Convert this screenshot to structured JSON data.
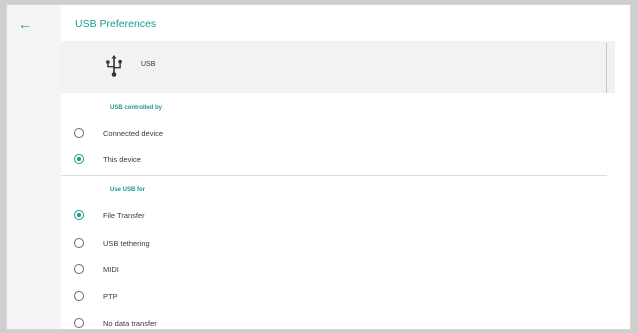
{
  "header": {
    "title": "USB Preferences"
  },
  "usb_item": {
    "label": "USB"
  },
  "controlled_by": {
    "heading": "USB controlled by",
    "options": [
      {
        "label": "Connected device",
        "checked": false
      },
      {
        "label": "This device",
        "checked": true
      }
    ]
  },
  "use_usb_for": {
    "heading": "Use USB for",
    "options": [
      {
        "label": "File Transfer",
        "checked": true
      },
      {
        "label": "USB tethering",
        "checked": false
      },
      {
        "label": "MIDI",
        "checked": false
      },
      {
        "label": "PTP",
        "checked": false
      },
      {
        "label": "No data transfer",
        "checked": false
      }
    ]
  },
  "colors": {
    "accent": "#1c9a8a"
  }
}
